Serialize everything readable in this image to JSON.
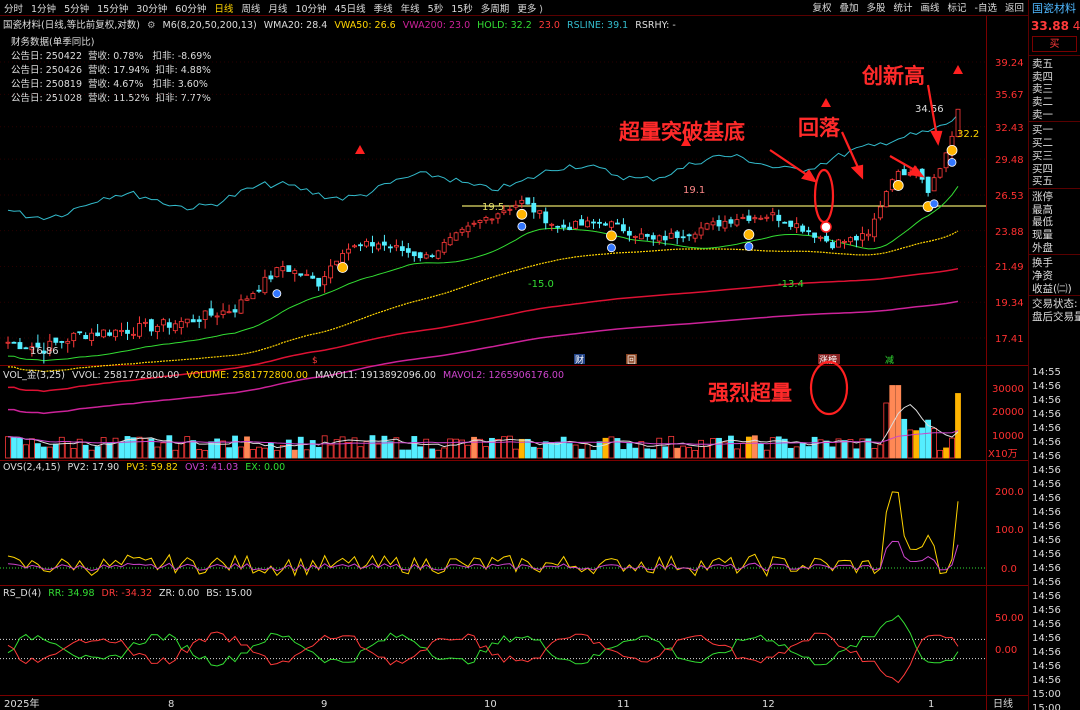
{
  "toolbar": {
    "timeframes": [
      "分时",
      "1分钟",
      "5分钟",
      "15分钟",
      "30分钟",
      "60分钟",
      "日线",
      "周线",
      "月线",
      "10分钟",
      "45日线",
      "季线",
      "年线",
      "5秒",
      "15秒",
      "多周期",
      "更多"
    ],
    "active": "日线",
    "right_tools": [
      "复权",
      "叠加",
      "多股",
      "统计",
      "画线",
      "标记",
      "-自选",
      "返回"
    ]
  },
  "main_legend": {
    "title": "国瓷材料(日线,等比前复权,对数)",
    "m6": "M6(8,20,50,200,13)",
    "wma20": "WMA20: 28.4",
    "vwa50": "VWA50: 26.6",
    "vwa200": "VWA200: 23.0",
    "hold": "HOLD: 32.2",
    "hold2": "23.0",
    "rsline": "RSLINE: 39.1",
    "rsrhy": "RSRHY: -"
  },
  "financials": {
    "title": "财务数据(单季同比)",
    "rows": [
      "公告日: 250422  营收: 0.78%   扣非: -8.69%",
      "公告日: 250426  营收: 17.94%  扣非: 4.88%",
      "公告日: 250819  营收: 4.67%   扣非: 3.60%",
      "公告日: 251028  营收: 11.52%  扣非: 7.77%"
    ]
  },
  "price_axis": [
    "39.24",
    "35.67",
    "32.43",
    "29.48",
    "26.53",
    "23.88",
    "21.49",
    "19.34",
    "17.41"
  ],
  "price_labels": {
    "low": "16.86",
    "a": "19.5",
    "b": "19.1",
    "c": "-15.0",
    "d": "-13.4",
    "e": "34.56",
    "f": "32.2"
  },
  "event_markers": [
    "$",
    "财",
    "回",
    "涨榜",
    "减"
  ],
  "annotations": {
    "breakout": "超量突破基底",
    "pullback": "回落",
    "new_high": "创新高",
    "volume": "强烈超量"
  },
  "volume_legend": {
    "name": "VOL_金(3,25)",
    "vvol": "VVOL: 2581772800.00",
    "volume": "VOLUME: 2581772800.00",
    "mavol1": "MAVOL1: 1913892096.00",
    "mavol2": "MAVOL2: 1265906176.00"
  },
  "volume_axis": [
    "30000",
    "20000",
    "10000"
  ],
  "volume_unit": "X10万",
  "ovs_legend": {
    "name": "OVS(2,4,15)",
    "pv2": "PV2: 17.90",
    "pv3": "PV3: 59.82",
    "ov3": "OV3: 41.03",
    "ex": "EX: 0.00"
  },
  "ovs_axis": [
    "200.0",
    "100.0",
    "0.0"
  ],
  "rs_legend": {
    "name": "RS_D(4)",
    "rr": "RR: 34.98",
    "dr": "DR: -34.32",
    "zr": "ZR: 0.00",
    "bs": "BS: 15.00"
  },
  "rs_axis": [
    "50.00",
    "0.00"
  ],
  "x_axis": [
    "2025年",
    "8",
    "9",
    "10",
    "11",
    "12",
    "1"
  ],
  "x_axis_right": "日线",
  "right_panel": {
    "stock": "国瓷材料",
    "price": "33.88",
    "price_suffix": "4.",
    "buy_btn": "买",
    "sell_levels": [
      "卖五",
      "卖四",
      "卖三",
      "卖二",
      "卖一"
    ],
    "buy_levels": [
      "买一",
      "买二",
      "买三",
      "买四",
      "买五"
    ],
    "stats": [
      "涨停",
      "最高",
      "最低",
      "现量",
      "外盘"
    ],
    "stats2": [
      "换手",
      "净资",
      "收益(㈡)"
    ],
    "status_label": "交易状态:",
    "status_value": "盘后交易量",
    "times": [
      "14:55",
      "14:56",
      "14:56",
      "14:56",
      "14:56",
      "14:56",
      "14:56",
      "14:56",
      "14:56",
      "14:56",
      "14:56",
      "14:56",
      "14:56",
      "14:56",
      "14:56",
      "14:56",
      "14:56",
      "14:56",
      "14:56",
      "14:56",
      "14:56",
      "14:56",
      "14:56",
      "15:00",
      "15:00"
    ]
  },
  "colors": {
    "up": "#ff3a3a",
    "down": "#55eeff",
    "gold": "#ffb400",
    "orange": "#ff8855",
    "ma_green": "#33dd33",
    "ma_yellow": "#ffd400",
    "ma_magenta": "#cc2299",
    "ma_red": "#dd1133",
    "rs_line": "#33bbcc"
  }
}
